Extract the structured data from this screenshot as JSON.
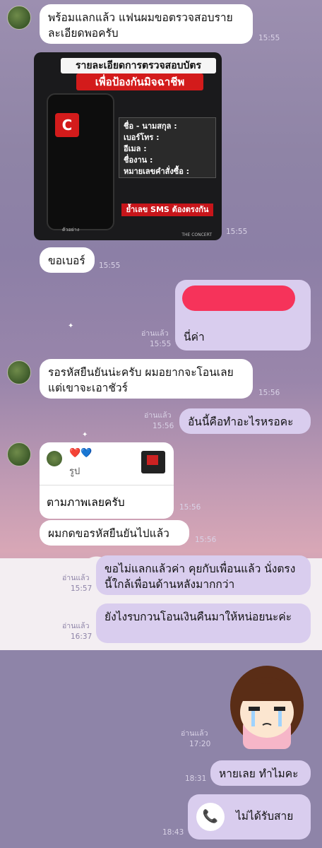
{
  "messages": [
    {
      "text": "พร้อมแลกแล้ว แฟนผมขอตรวจสอบรายละเอียดพอครับ",
      "time": "15:55"
    },
    {
      "time": "15:55"
    },
    {
      "text": "ขอเบอร์",
      "time": "15:55"
    },
    {
      "text": "นี่ค่า",
      "read": "อ่านแล้ว",
      "time": "15:55"
    },
    {
      "text": "รอรหัสยืนยันน่ะครับ ผมอยากจะโอนเลย แต่เขาจะเอาชัวร์",
      "time": "15:56"
    },
    {
      "text": "อันนี้คือทำอะไรหรอคะ",
      "read": "อ่านแล้ว",
      "time": "15:56"
    },
    {
      "card_title": "รูป",
      "text": "ตามภาพเลยครับ",
      "time": "15:56"
    },
    {
      "text": "ผมกดขอรหัสยืนยันไปแล้ว",
      "time": "15:56"
    },
    {
      "text": "ขอไม่แลกแล้วค่า คุยกับเพื่อนแล้ว นั่งตรงนี้ใกล้เพื่อนด้านหลังมากกว่า",
      "read": "อ่านแล้ว",
      "time": "15:57"
    },
    {
      "text": "ยังไงรบกวนโอนเงินคืนมาให้หน่อยนะค่ะ",
      "read": "อ่านแล้ว",
      "time": "16:37"
    },
    {
      "read": "อ่านแล้ว",
      "time": "17:20"
    },
    {
      "text": "หายเลย ทำไมคะ",
      "time": "18:31"
    },
    {
      "text": "ไม่ได้รับสาย",
      "time": "18:43"
    }
  ],
  "promo": {
    "title1": "รายละเอียดการตรวจสอบบัตร",
    "title2": "เพื่อป้องกันมิจฉาชีพ",
    "form": [
      "ชื่อ - นามสกุล :",
      "เบอร์โทร :",
      "อีเมล :",
      "ชื่องาน :",
      "หมายเลขคำสั่งซื้อ :"
    ],
    "sms": "ย้ำเลข SMS ต้องตรงกัน",
    "caption": "ตัวอย่าง",
    "brand": "THE CONCERT",
    "phone_logo": "C"
  },
  "icons": {
    "card_hearts": "❤️💙",
    "call": "📞"
  },
  "colors": {
    "incoming": "#ffffff",
    "outgoing": "#d9cdee",
    "redaction": "#f6335a"
  }
}
